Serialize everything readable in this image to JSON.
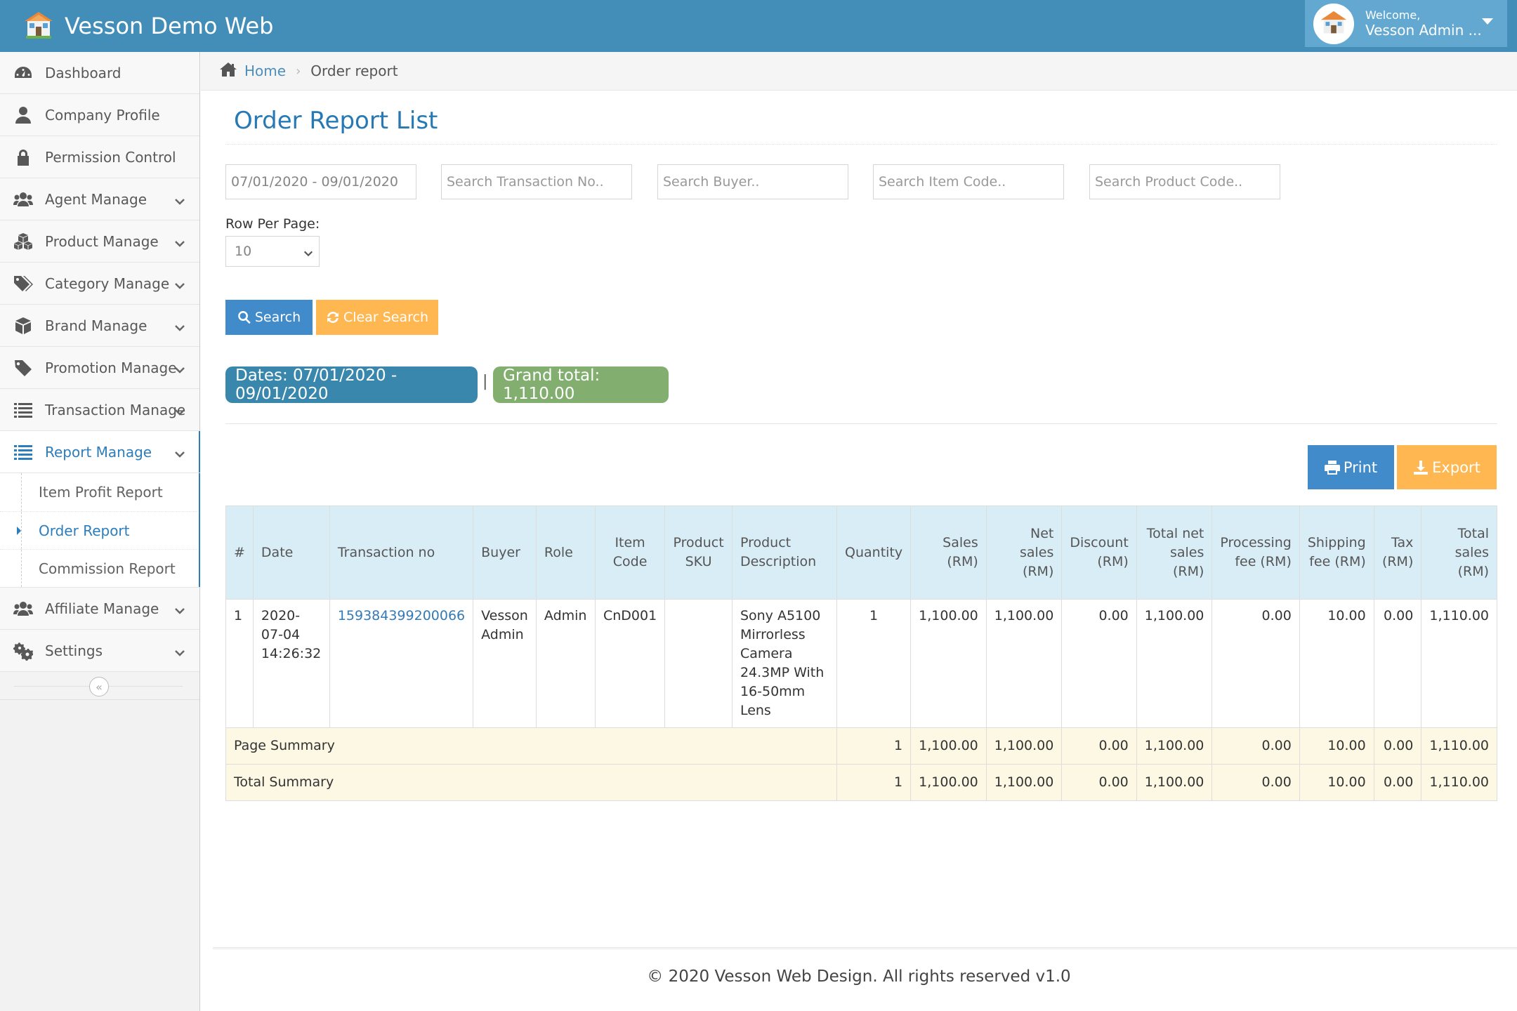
{
  "app": {
    "title": "Vesson Demo Web"
  },
  "user": {
    "welcome": "Welcome,",
    "name": "Vesson Admin ..."
  },
  "sidebar": {
    "items": [
      {
        "label": "Dashboard",
        "icon": "dashboard-icon"
      },
      {
        "label": "Company Profile",
        "icon": "user-icon"
      },
      {
        "label": "Permission Control",
        "icon": "lock-icon"
      },
      {
        "label": "Agent Manage",
        "icon": "users-icon"
      },
      {
        "label": "Product Manage",
        "icon": "cubes-icon"
      },
      {
        "label": "Category Manage",
        "icon": "tags-icon"
      },
      {
        "label": "Brand Manage",
        "icon": "cube-icon"
      },
      {
        "label": "Promotion Manage",
        "icon": "tag-icon"
      },
      {
        "label": "Transaction Manage",
        "icon": "list-icon"
      },
      {
        "label": "Report Manage",
        "icon": "list-alt-icon"
      },
      {
        "label": "Affiliate Manage",
        "icon": "users-icon"
      },
      {
        "label": "Settings",
        "icon": "gears-icon"
      }
    ],
    "report_submenu": [
      "Item Profit Report",
      "Order Report",
      "Commission Report"
    ],
    "collapse_glyph": "«"
  },
  "breadcrumb": {
    "home": "Home",
    "current": "Order report"
  },
  "page": {
    "title": "Order Report List"
  },
  "filters": {
    "date_range": "07/01/2020 - 09/01/2020",
    "transaction_placeholder": "Search Transaction No..",
    "buyer_placeholder": "Search Buyer..",
    "item_code_placeholder": "Search Item Code..",
    "product_code_placeholder": "Search Product Code..",
    "row_per_page_label": "Row Per Page:",
    "row_per_page_value": "10"
  },
  "buttons": {
    "search": "Search",
    "clear": "Clear Search",
    "print": "Print",
    "export": "Export"
  },
  "summary_badges": {
    "dates": "Dates: 07/01/2020 - 09/01/2020",
    "separator": "|",
    "grand_total": "Grand total: 1,110.00"
  },
  "table": {
    "headers": {
      "num": "#",
      "date": "Date",
      "transaction": "Transaction no",
      "buyer": "Buyer",
      "role": "Role",
      "item_code": "Item Code",
      "sku": "Product SKU",
      "desc": "Product Description",
      "qty": "Quantity",
      "sales": "Sales (RM)",
      "net_sales": "Net sales (RM)",
      "discount": "Discount (RM)",
      "total_net": "Total net sales (RM)",
      "processing": "Processing fee (RM)",
      "shipping": "Shipping fee (RM)",
      "tax": "Tax (RM)",
      "total_sales": "Total sales (RM)"
    },
    "rows": [
      {
        "num": "1",
        "date": "2020-07-04 14:26:32",
        "transaction": "159384399200066",
        "buyer": "Vesson Admin",
        "role": "Admin",
        "item_code": "CnD001",
        "sku": "",
        "desc": "Sony A5100 Mirrorless Camera 24.3MP With 16-50mm Lens",
        "qty": "1",
        "sales": "1,100.00",
        "net_sales": "1,100.00",
        "discount": "0.00",
        "total_net": "1,100.00",
        "processing": "0.00",
        "shipping": "10.00",
        "tax": "0.00",
        "total_sales": "1,110.00"
      }
    ],
    "page_summary": {
      "label": "Page Summary",
      "qty": "1",
      "sales": "1,100.00",
      "net_sales": "1,100.00",
      "discount": "0.00",
      "total_net": "1,100.00",
      "processing": "0.00",
      "shipping": "10.00",
      "tax": "0.00",
      "total_sales": "1,110.00"
    },
    "total_summary": {
      "label": "Total Summary",
      "qty": "1",
      "sales": "1,100.00",
      "net_sales": "1,100.00",
      "discount": "0.00",
      "total_net": "1,100.00",
      "processing": "0.00",
      "shipping": "10.00",
      "tax": "0.00",
      "total_sales": "1,110.00"
    }
  },
  "footer": {
    "text": "© 2020 Vesson Web Design. All rights reserved v1.0"
  },
  "colors": {
    "navbar": "#438eb9",
    "accent": "#2b7dbc",
    "button_primary": "#428bca",
    "button_warning": "#ffb752",
    "badge_info": "#3a87ad",
    "badge_success": "#82af6f",
    "table_header": "#d9edf7",
    "summary_row": "#fcf8e3"
  }
}
